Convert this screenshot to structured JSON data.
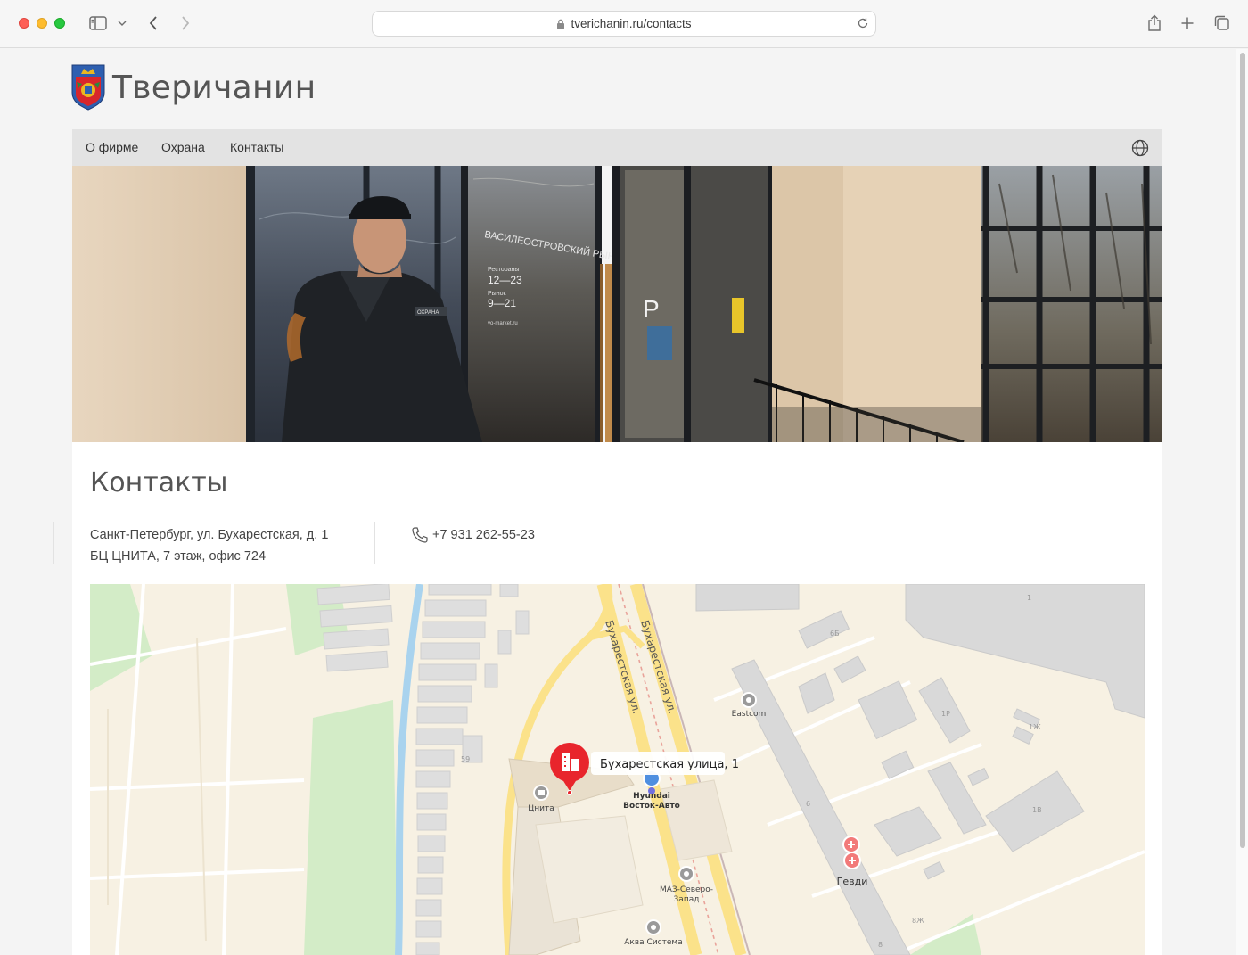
{
  "browser": {
    "url": "tverichanin.ru/contacts"
  },
  "site": {
    "name": "Тверичанин"
  },
  "nav": {
    "items": [
      {
        "label": "О фирме"
      },
      {
        "label": "Охрана"
      },
      {
        "label": "Контакты"
      }
    ]
  },
  "hero": {
    "sign_title": "ВАСИЛЕОСТРОВСКИЙ РЫНОК",
    "sign_restaurant_label": "Рестораны",
    "sign_restaurant_hours": "12—23",
    "sign_market_label": "Рынок",
    "sign_market_hours": "9—21",
    "sign_site": "vo-market.ru",
    "patch_text": "ОХРАНА"
  },
  "contacts": {
    "title": "Контакты",
    "address_line1": "Санкт-Петербург, ул. Бухарестская, д. 1",
    "address_line2": "БЦ ЦНИТА, 7 этаж, офис 724",
    "phone": "+7 931 262-55-23"
  },
  "map": {
    "street_label_1": "Бухарестская ул.",
    "street_label_2": "Бухарестская ул.",
    "marker_label": "Бухарестская улица, 1",
    "poi_tsnita": "Цнита",
    "poi_hyundai_1": "Hyundai",
    "poi_hyundai_2": "Восток-Авто",
    "poi_eastcom": "Eastcom",
    "poi_maz_1": "МАЗ-Северо-",
    "poi_maz_2": "Запад",
    "poi_akva": "Аква Система",
    "poi_gevdi": "Гевди",
    "house_1": "1",
    "house_6b": "6Б",
    "house_1r": "1Р",
    "house_1zh": "1Ж",
    "house_1v": "1В",
    "house_59": "59",
    "house_6": "6",
    "house_8zh": "8Ж",
    "house_8": "8",
    "colors": {
      "road_major": "#fbe28a",
      "water": "#a9d3ee",
      "park": "#d3ecc7",
      "marker": "#e8252c"
    }
  }
}
